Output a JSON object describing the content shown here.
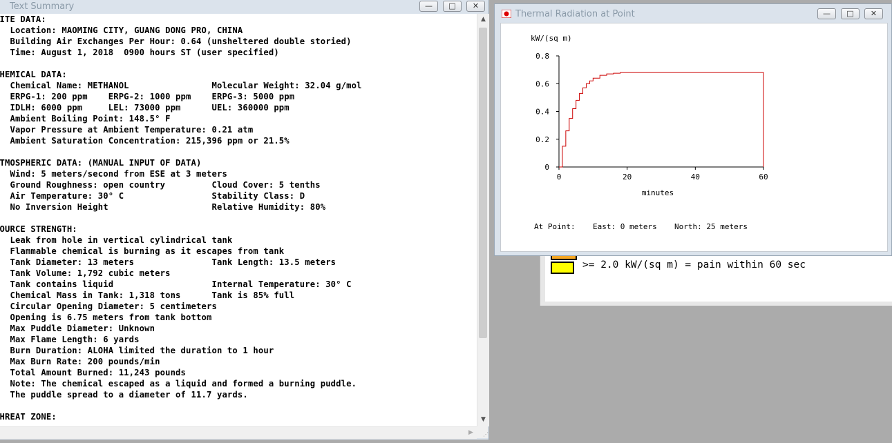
{
  "text_summary": {
    "title": "Text Summary",
    "lines": [
      "SITE DATA:",
      "   Location: MAOMING CITY, GUANG DONG PRO, CHINA",
      "   Building Air Exchanges Per Hour: 0.64 (unsheltered double storied)",
      "   Time: August 1, 2018  0900 hours ST (user specified)",
      "",
      "CHEMICAL DATA:",
      "   Chemical Name: METHANOL                Molecular Weight: 32.04 g/mol",
      "   ERPG-1: 200 ppm    ERPG-2: 1000 ppm    ERPG-3: 5000 ppm",
      "   IDLH: 6000 ppm     LEL: 73000 ppm      UEL: 360000 ppm",
      "   Ambient Boiling Point: 148.5° F",
      "   Vapor Pressure at Ambient Temperature: 0.21 atm",
      "   Ambient Saturation Concentration: 215,396 ppm or 21.5%",
      "",
      "ATMOSPHERIC DATA: (MANUAL INPUT OF DATA)",
      "   Wind: 5 meters/second from ESE at 3 meters",
      "   Ground Roughness: open country         Cloud Cover: 5 tenths",
      "   Air Temperature: 30° C                 Stability Class: D",
      "   No Inversion Height                    Relative Humidity: 80%",
      "",
      "SOURCE STRENGTH:",
      "   Leak from hole in vertical cylindrical tank",
      "   Flammable chemical is burning as it escapes from tank",
      "   Tank Diameter: 13 meters               Tank Length: 13.5 meters",
      "   Tank Volume: 1,792 cubic meters",
      "   Tank contains liquid                   Internal Temperature: 30° C",
      "   Chemical Mass in Tank: 1,318 tons      Tank is 85% full",
      "   Circular Opening Diameter: 5 centimeters",
      "   Opening is 6.75 meters from tank bottom",
      "   Max Puddle Diameter: Unknown",
      "   Max Flame Length: 6 yards",
      "   Burn Duration: ALOHA limited the duration to 1 hour",
      "   Max Burn Rate: 200 pounds/min",
      "   Total Amount Burned: 11,243 pounds",
      "   Note: The chemical escaped as a liquid and formed a burning puddle.",
      "   The puddle spread to a diameter of 11.7 yards.",
      "",
      "THREAT ZONE:"
    ]
  },
  "legend": {
    "line2": ">= 2.0 kW/(sq m) = pain within 60 sec",
    "line2_color": "#ffff00"
  },
  "thermal": {
    "title": "Thermal Radiation at Point",
    "footer_label": "At Point:",
    "east": "East: 0 meters",
    "north": "North: 25 meters"
  },
  "chart_data": {
    "type": "line",
    "title": "",
    "ylabel": "kW/(sq m)",
    "xlabel": "minutes",
    "xlim": [
      0,
      60
    ],
    "ylim": [
      0,
      0.8
    ],
    "x_ticks": [
      0,
      20,
      40,
      60
    ],
    "y_ticks": [
      0,
      0.2,
      0.4,
      0.6,
      0.8
    ],
    "x_tick_labels": [
      "0",
      "20",
      "40",
      "60"
    ],
    "y_tick_labels": [
      "0",
      "0.2",
      "0.4",
      "0.6",
      "0.8"
    ],
    "line_color": "#cc0000",
    "series": [
      {
        "x": [
          0,
          1,
          2,
          3,
          4,
          5,
          6,
          7,
          8,
          9,
          10,
          12,
          14,
          16,
          18,
          20,
          25,
          30,
          40,
          50,
          60,
          60
        ],
        "y": [
          0,
          0.15,
          0.26,
          0.35,
          0.42,
          0.48,
          0.53,
          0.57,
          0.6,
          0.62,
          0.64,
          0.66,
          0.67,
          0.675,
          0.68,
          0.68,
          0.68,
          0.68,
          0.68,
          0.68,
          0.68,
          0
        ]
      }
    ]
  },
  "colors": {
    "desktop": "#ababab",
    "chrome": "#dbe3ec"
  }
}
